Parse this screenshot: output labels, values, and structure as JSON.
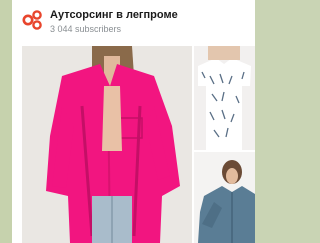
{
  "channel": {
    "title": "Аутсорсинг в легпроме",
    "subscribers": "3 044 subscribers",
    "logo_icon": "brand-logo-icon"
  },
  "media": {
    "photos": [
      {
        "name": "photo-pink-shirt"
      },
      {
        "name": "photo-printed-tshirt"
      },
      {
        "name": "photo-denim-shirt"
      }
    ]
  },
  "colors": {
    "accent_logo": "#e8452c",
    "pink_shirt": "#f21580",
    "denim": "#5a7d95",
    "background": "#c6d2ad"
  }
}
